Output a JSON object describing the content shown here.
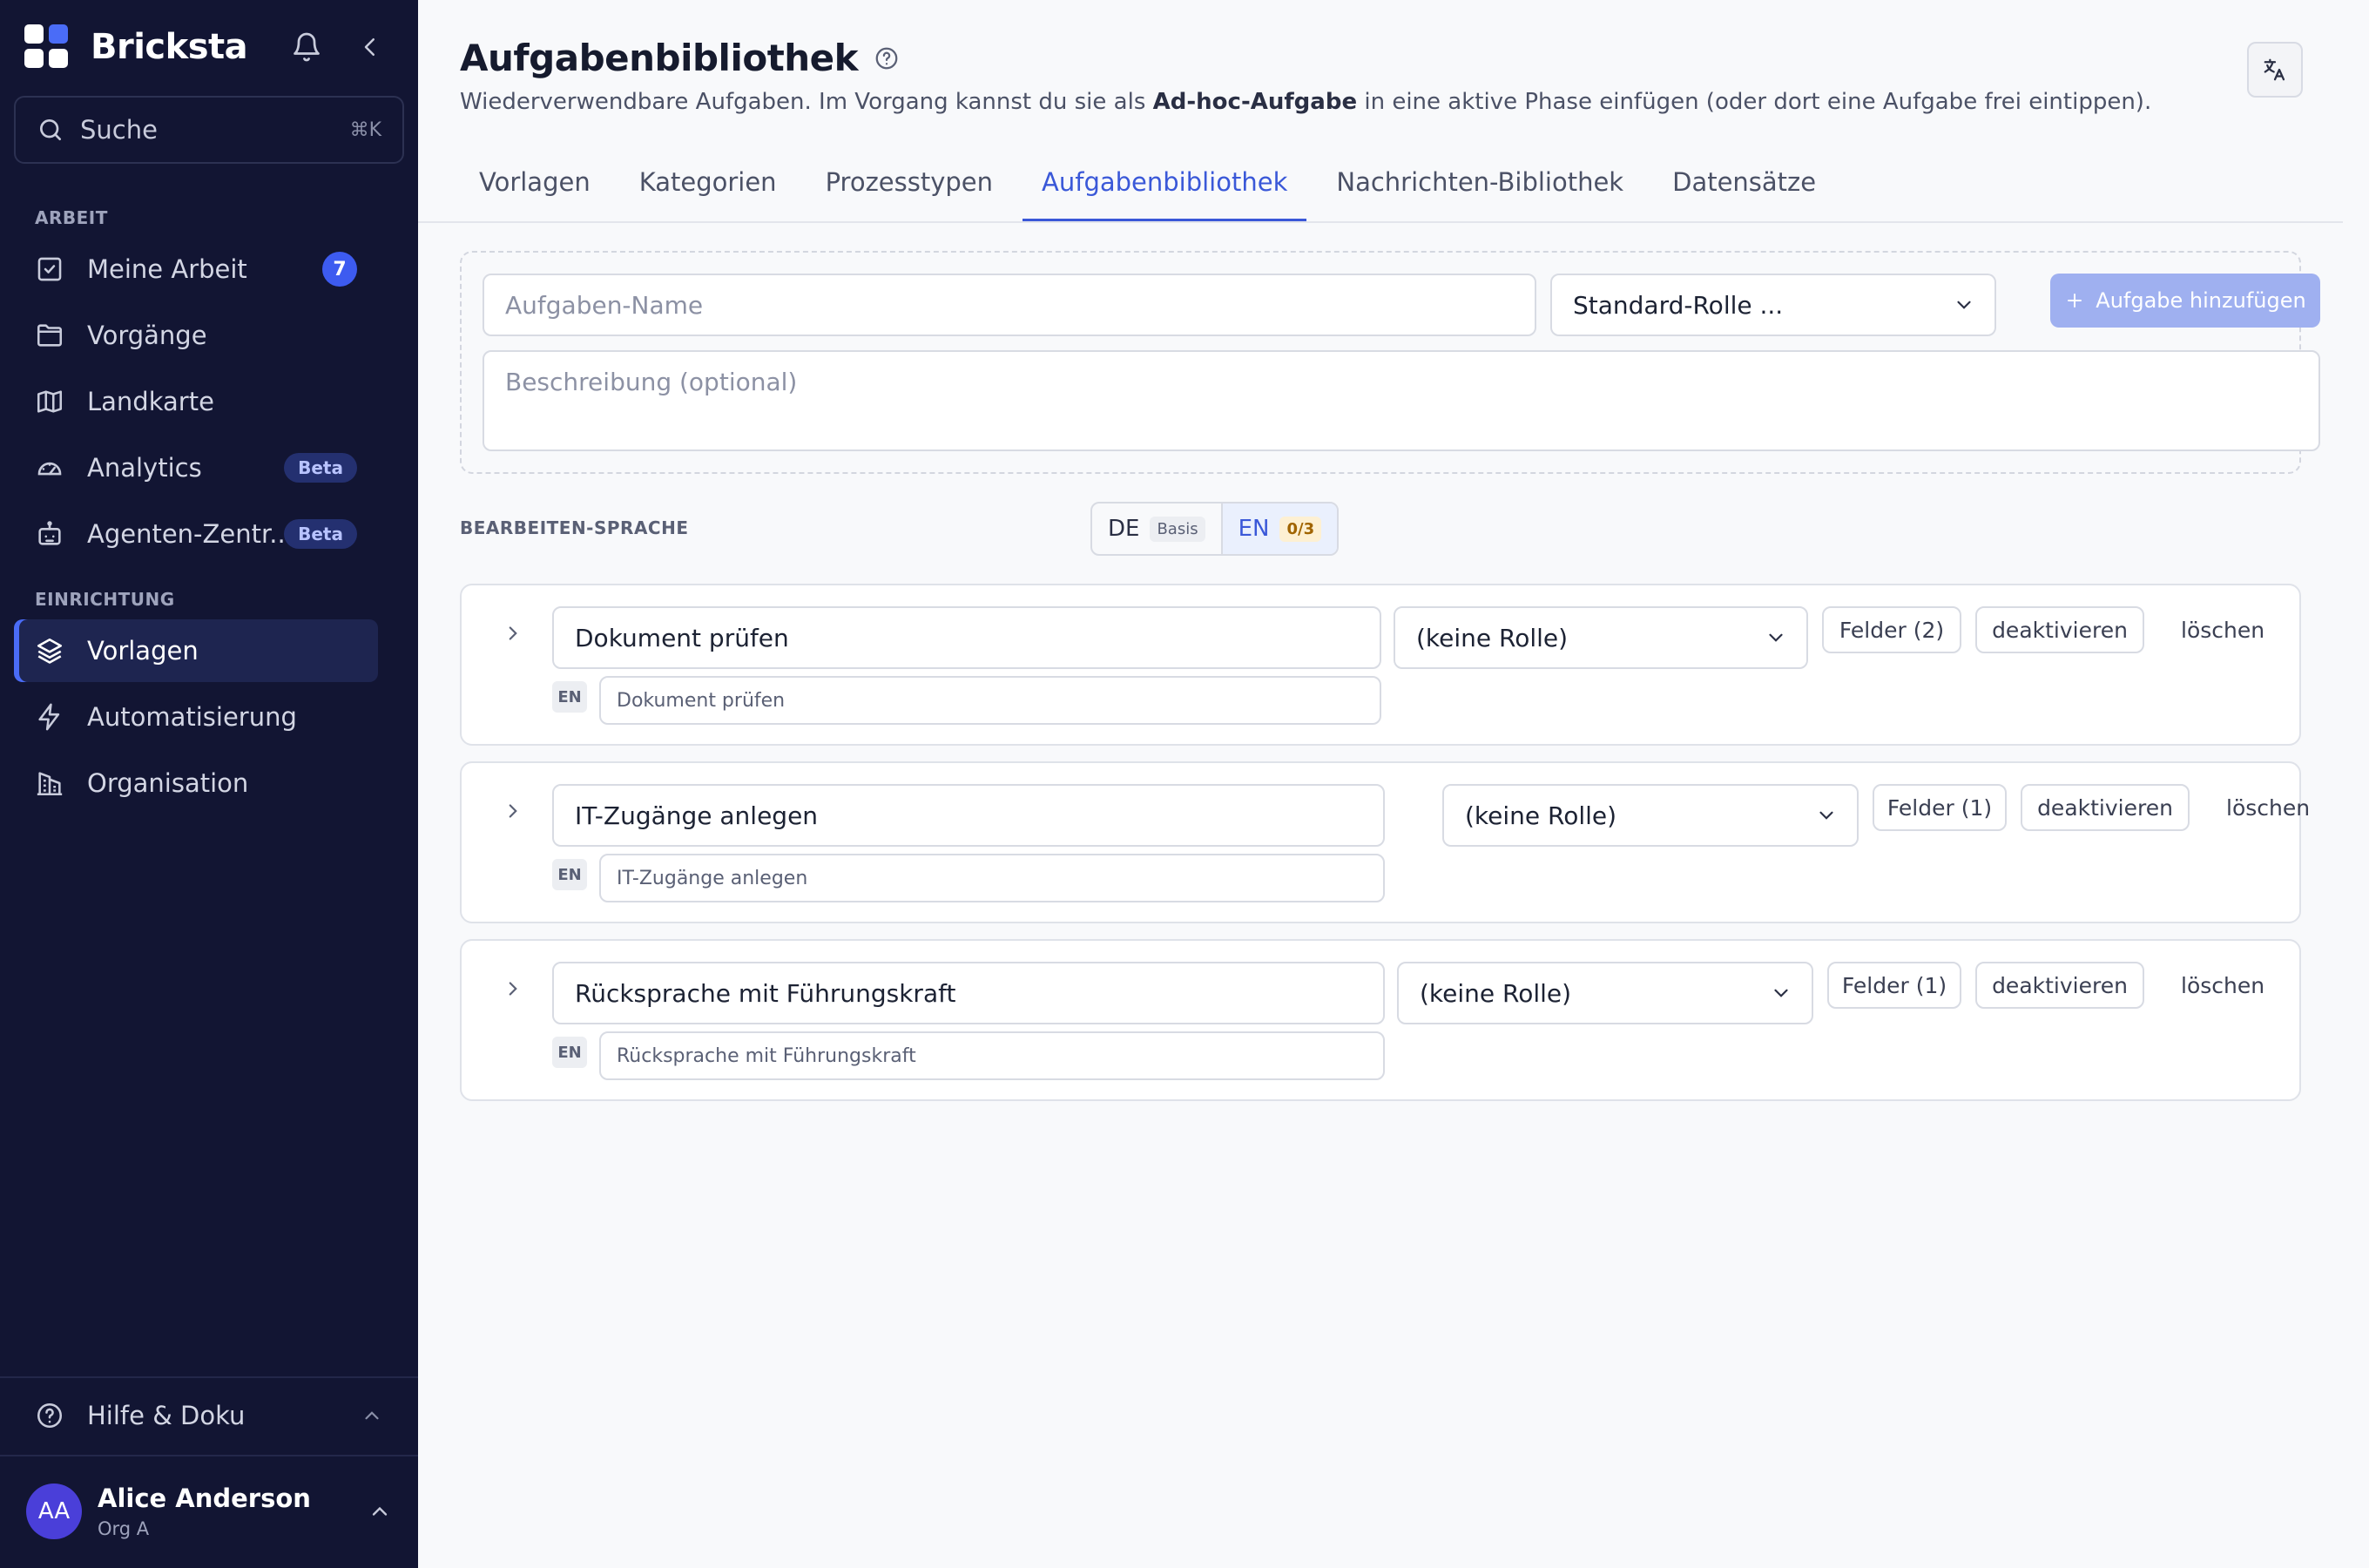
{
  "app": {
    "name": "Bricksta"
  },
  "sidebar": {
    "search": {
      "placeholder": "Suche",
      "shortcut": "⌘K"
    },
    "sections": [
      {
        "label": "ARBEIT"
      },
      {
        "label": "EINRICHTUNG"
      }
    ],
    "items": [
      {
        "label": "Meine Arbeit",
        "icon": "check-square-icon",
        "badge": "7"
      },
      {
        "label": "Vorgänge",
        "icon": "folder-icon"
      },
      {
        "label": "Landkarte",
        "icon": "map-icon"
      },
      {
        "label": "Analytics",
        "icon": "gauge-icon",
        "badge": "Beta"
      },
      {
        "label": "Agenten-Zentr...",
        "icon": "robot-icon",
        "badge": "Beta"
      },
      {
        "label": "Vorlagen",
        "icon": "layers-icon",
        "active": true
      },
      {
        "label": "Automatisierung",
        "icon": "lightning-icon"
      },
      {
        "label": "Organisation",
        "icon": "building-icon"
      }
    ],
    "help": {
      "label": "Hilfe & Doku"
    },
    "user": {
      "initials": "AA",
      "name": "Alice Anderson",
      "org": "Org A"
    }
  },
  "page": {
    "title": "Aufgabenbibliothek",
    "subtitle_pre": "Wiederverwendbare Aufgaben. Im Vorgang kannst du sie als ",
    "subtitle_bold": "Ad-hoc-Aufgabe",
    "subtitle_post": " in eine aktive Phase einfügen (oder dort eine Aufgabe frei eintippen).",
    "tabs": [
      "Vorlagen",
      "Kategorien",
      "Prozesstypen",
      "Aufgabenbibliothek",
      "Nachrichten-Bibliothek",
      "Datensätze"
    ],
    "active_tab": "Aufgabenbibliothek"
  },
  "new_task": {
    "name_placeholder": "Aufgaben-Name",
    "role_placeholder": "Standard-Rolle ...",
    "description_placeholder": "Beschreibung (optional)",
    "add_label": "Aufgabe hinzufügen"
  },
  "language": {
    "label": "BEARBEITEN-SPRACHE",
    "options": [
      {
        "code": "DE",
        "tag": "Basis"
      },
      {
        "code": "EN",
        "tag": "0/3",
        "active": true
      }
    ]
  },
  "tasks": [
    {
      "name": "Dokument prüfen",
      "role": "(keine Rolle)",
      "fields": "Felder (2)",
      "deactivate": "deaktivieren",
      "delete": "löschen",
      "lang": "EN",
      "translation_placeholder": "Dokument prüfen"
    },
    {
      "name": "IT-Zugänge anlegen",
      "role": "(keine Rolle)",
      "fields": "Felder (1)",
      "deactivate": "deaktivieren",
      "delete": "löschen",
      "lang": "EN",
      "translation_placeholder": "IT-Zugänge anlegen"
    },
    {
      "name": "Rücksprache mit Führungskraft",
      "role": "(keine Rolle)",
      "fields": "Felder (1)",
      "deactivate": "deaktivieren",
      "delete": "löschen",
      "lang": "EN",
      "translation_placeholder": "Rücksprache mit Führungskraft"
    }
  ],
  "colors": {
    "sidebar_bg": "#121533",
    "accent": "#3a58d8",
    "badge": "#3d5bf0"
  }
}
